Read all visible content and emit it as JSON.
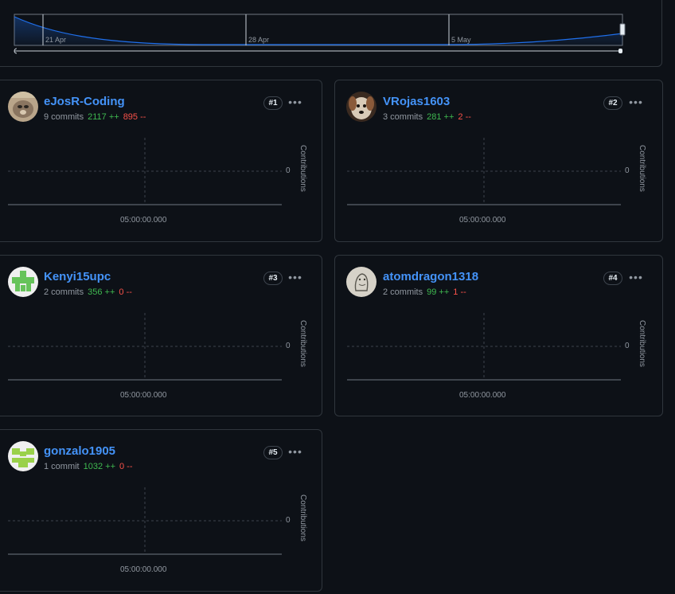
{
  "timeline": {
    "ticks": [
      "21 Apr",
      "28 Apr",
      "5 May"
    ]
  },
  "contributors": [
    {
      "username": "eJosR-Coding",
      "commits": "9 commits",
      "additions": "2117 ++",
      "deletions": "895 --",
      "rank": "#1",
      "avatar": "photo-cat"
    },
    {
      "username": "VRojas1603",
      "commits": "3 commits",
      "additions": "281 ++",
      "deletions": "2 --",
      "rank": "#2",
      "avatar": "photo-dog"
    },
    {
      "username": "Kenyi15upc",
      "commits": "2 commits",
      "additions": "356 ++",
      "deletions": "0 --",
      "rank": "#3",
      "avatar": "identicon-green"
    },
    {
      "username": "atomdragon1318",
      "commits": "2 commits",
      "additions": "99 ++",
      "deletions": "1 --",
      "rank": "#4",
      "avatar": "drawing-creature"
    },
    {
      "username": "gonzalo1905",
      "commits": "1 commit",
      "additions": "1032 ++",
      "deletions": "0 --",
      "rank": "#5",
      "avatar": "identicon-lime"
    }
  ],
  "chart": {
    "ylabel": "Contributions",
    "zero_tick": "0",
    "x_tick": "05:00:00.000"
  },
  "colors": {
    "background": "#0d1117",
    "border": "#30363d",
    "link": "#4493f8",
    "additions": "#3fb950",
    "deletions": "#f85149",
    "muted": "#9198a1",
    "timeline_line": "#1f6feb"
  }
}
